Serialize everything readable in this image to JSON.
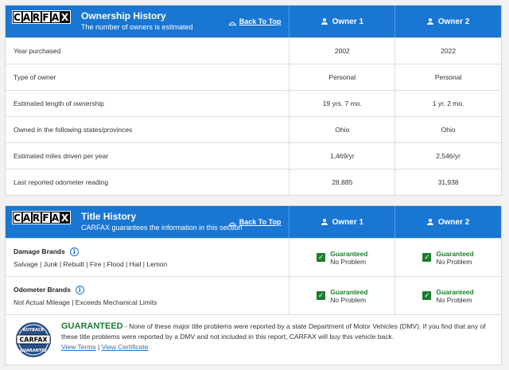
{
  "logo_letters": [
    "C",
    "A",
    "R",
    "F",
    "A",
    "X"
  ],
  "ownership": {
    "title": "Ownership History",
    "subtitle": "The number of owners is estimated",
    "back_to_top": "Back To Top",
    "owners": [
      "Owner 1",
      "Owner 2"
    ],
    "rows": [
      {
        "label": "Year purchased",
        "values": [
          "2002",
          "2022"
        ]
      },
      {
        "label": "Type of owner",
        "values": [
          "Personal",
          "Personal"
        ]
      },
      {
        "label": "Estimated length of ownership",
        "values": [
          "19 yrs. 7 mo.",
          "1 yr. 2 mo."
        ]
      },
      {
        "label": "Owned in the following states/provinces",
        "values": [
          "Ohio",
          "Ohio"
        ]
      },
      {
        "label": "Estimated miles driven per year",
        "values": [
          "1,469/yr",
          "2,546/yr"
        ]
      },
      {
        "label": "Last reported odometer reading",
        "values": [
          "28,885",
          "31,938"
        ]
      }
    ]
  },
  "title_history": {
    "title": "Title History",
    "subtitle": "CARFAX guarantees the information in this section",
    "back_to_top": "Back To Top",
    "owners": [
      "Owner 1",
      "Owner 2"
    ],
    "rows": [
      {
        "title": "Damage Brands",
        "list": "Salvage | Junk | Rebuilt | Fire | Flood | Hail | Lemon",
        "status_top": "Guaranteed",
        "status_bottom": "No Problem"
      },
      {
        "title": "Odometer Brands",
        "list": "Not Actual Mileage | Exceeds Mechanical Limits",
        "status_top": "Guaranteed",
        "status_bottom": "No Problem"
      }
    ],
    "guarantee": {
      "heading": "GUARANTEED",
      "text": " - None of these major title problems were reported by a state Department of Motor Vehicles (DMV). If you find that any of these title problems were reported by a DMV and not included in this report, CARFAX will buy this vehicle back.",
      "view_terms": "View Terms",
      "separator": " | ",
      "view_certificate": "View Certificate",
      "badge_top": "BUYBACK",
      "badge_bottom": "GUARANTEE",
      "badge_center": "CARFAX"
    }
  },
  "colors": {
    "header_blue": "#1976d2",
    "guaranteed_green": "#1b7d2e"
  }
}
